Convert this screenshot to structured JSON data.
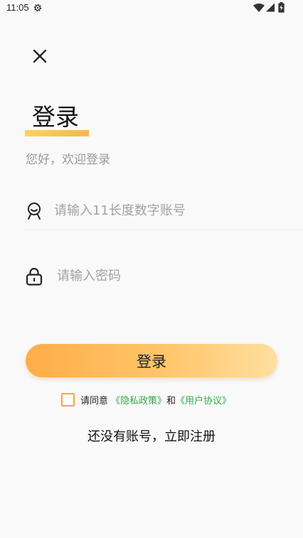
{
  "status_bar": {
    "time": "11:05",
    "icons": [
      "gear-icon",
      "wifi-icon",
      "signal-icon",
      "battery-icon"
    ]
  },
  "header": {
    "close_icon": "close-icon",
    "title": "登录",
    "subtitle": "您好，欢迎登录"
  },
  "form": {
    "account": {
      "icon": "user-face-icon",
      "placeholder": "请输入11长度数字账号",
      "value": ""
    },
    "password": {
      "icon": "lock-icon",
      "placeholder": "请输入密码",
      "value": ""
    },
    "login_label": "登录"
  },
  "agreement": {
    "checked": false,
    "prefix": "请同意",
    "privacy_link": "《隐私政策》",
    "and": "和",
    "user_link": "《用户协议》"
  },
  "register_text": "还没有账号，立即注册",
  "colors": {
    "accent": "#ffad48",
    "link": "#2eaa4a",
    "placeholder": "#a2a2a2"
  }
}
